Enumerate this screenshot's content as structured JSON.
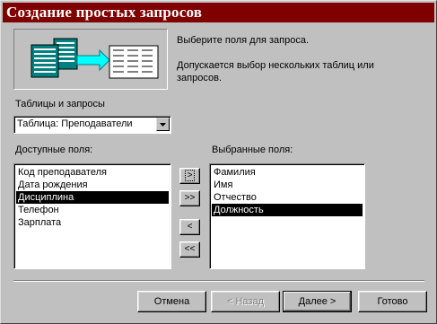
{
  "window": {
    "title": "Создание простых запросов"
  },
  "intro": {
    "line1": "Выберите поля для запроса.",
    "line2": "Допускается выбор нескольких таблиц или",
    "line3": "запросов."
  },
  "tables": {
    "label": "Таблицы и запросы",
    "selected": "Таблица: Преподаватели"
  },
  "available": {
    "label": "Доступные поля:",
    "items": [
      "Код преподавателя",
      "Дата рождения",
      "Дисциплина",
      "Телефон",
      "Зарплата"
    ],
    "selected_index": 2
  },
  "chosen": {
    "label": "Выбранные поля:",
    "items": [
      "Фамилия",
      "Имя",
      "Отчество",
      "Должность"
    ],
    "selected_index": 3
  },
  "move_buttons": {
    "add_one": ">",
    "add_all": ">>",
    "remove_one": "<",
    "remove_all": "<<"
  },
  "buttons": {
    "cancel": "Отмена",
    "back": "< Назад",
    "next": "Далее >",
    "finish": "Готово"
  },
  "colors": {
    "titlebar": "#800000",
    "face": "#c0c0c0",
    "selection": "#000000",
    "picture_arrow": "#00ffff",
    "picture_table": "#008080"
  },
  "icons": {
    "dropdown": "chevron-down-icon",
    "illustration": "query-tables-illustration"
  }
}
